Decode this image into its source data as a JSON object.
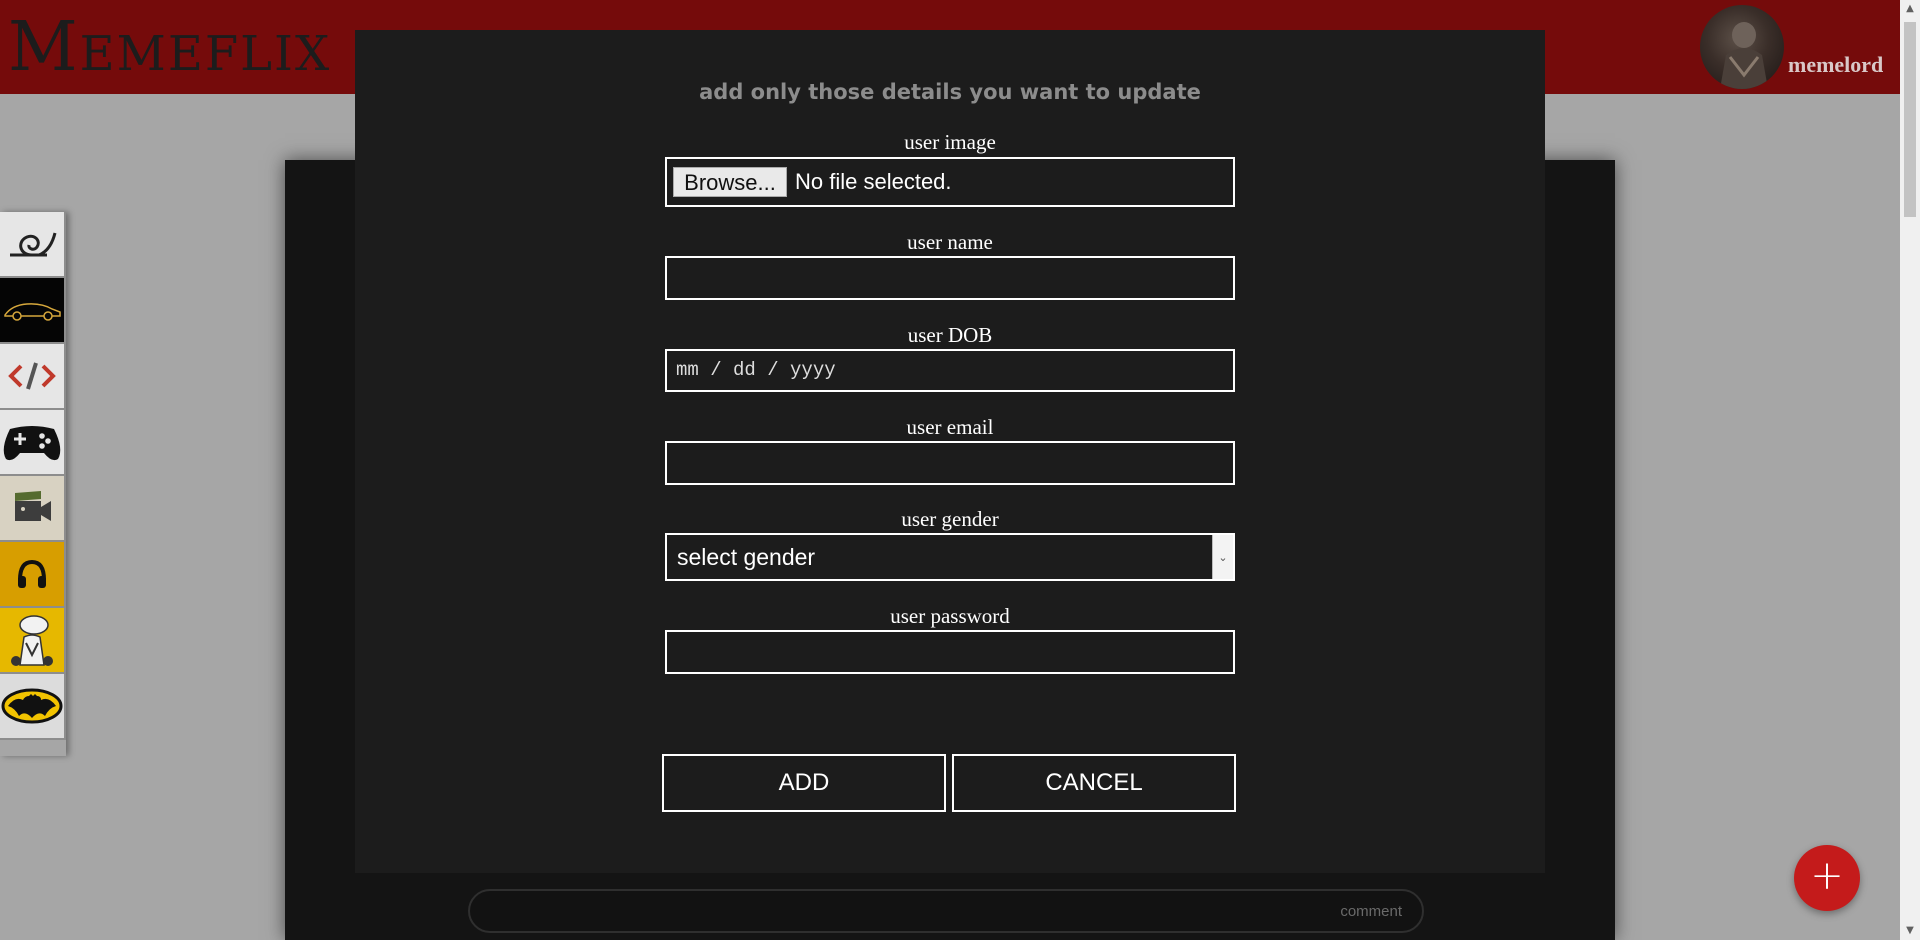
{
  "header": {
    "logo": "Memeflix",
    "username": "memelord",
    "brand_color": "#750b0b"
  },
  "sidebar": {
    "items": [
      {
        "icon": "leaf-village-swirl-icon",
        "name": "naruto"
      },
      {
        "icon": "sports-car-icon",
        "name": "cars"
      },
      {
        "icon": "code-brackets-icon",
        "name": "coding"
      },
      {
        "icon": "gamepad-icon",
        "name": "gaming"
      },
      {
        "icon": "movie-camera-icon",
        "name": "movies"
      },
      {
        "icon": "headphones-icon",
        "name": "music"
      },
      {
        "icon": "cartoon-character-icon",
        "name": "cartoons"
      },
      {
        "icon": "batman-logo-icon",
        "name": "superheroes"
      }
    ]
  },
  "background": {
    "comment_placeholder": "comment"
  },
  "fab": {
    "label": "+"
  },
  "modal": {
    "title": "add only those details you want to update",
    "fields": {
      "image": {
        "label": "user image",
        "browse_label": "Browse...",
        "status": "No file selected."
      },
      "name": {
        "label": "user name",
        "value": ""
      },
      "dob": {
        "label": "user DOB",
        "placeholder": "mm / dd / yyyy"
      },
      "email": {
        "label": "user email",
        "value": ""
      },
      "gender": {
        "label": "user gender",
        "selected": "select gender"
      },
      "password": {
        "label": "user password",
        "value": ""
      }
    },
    "buttons": {
      "add": "ADD",
      "cancel": "CANCEL"
    }
  }
}
